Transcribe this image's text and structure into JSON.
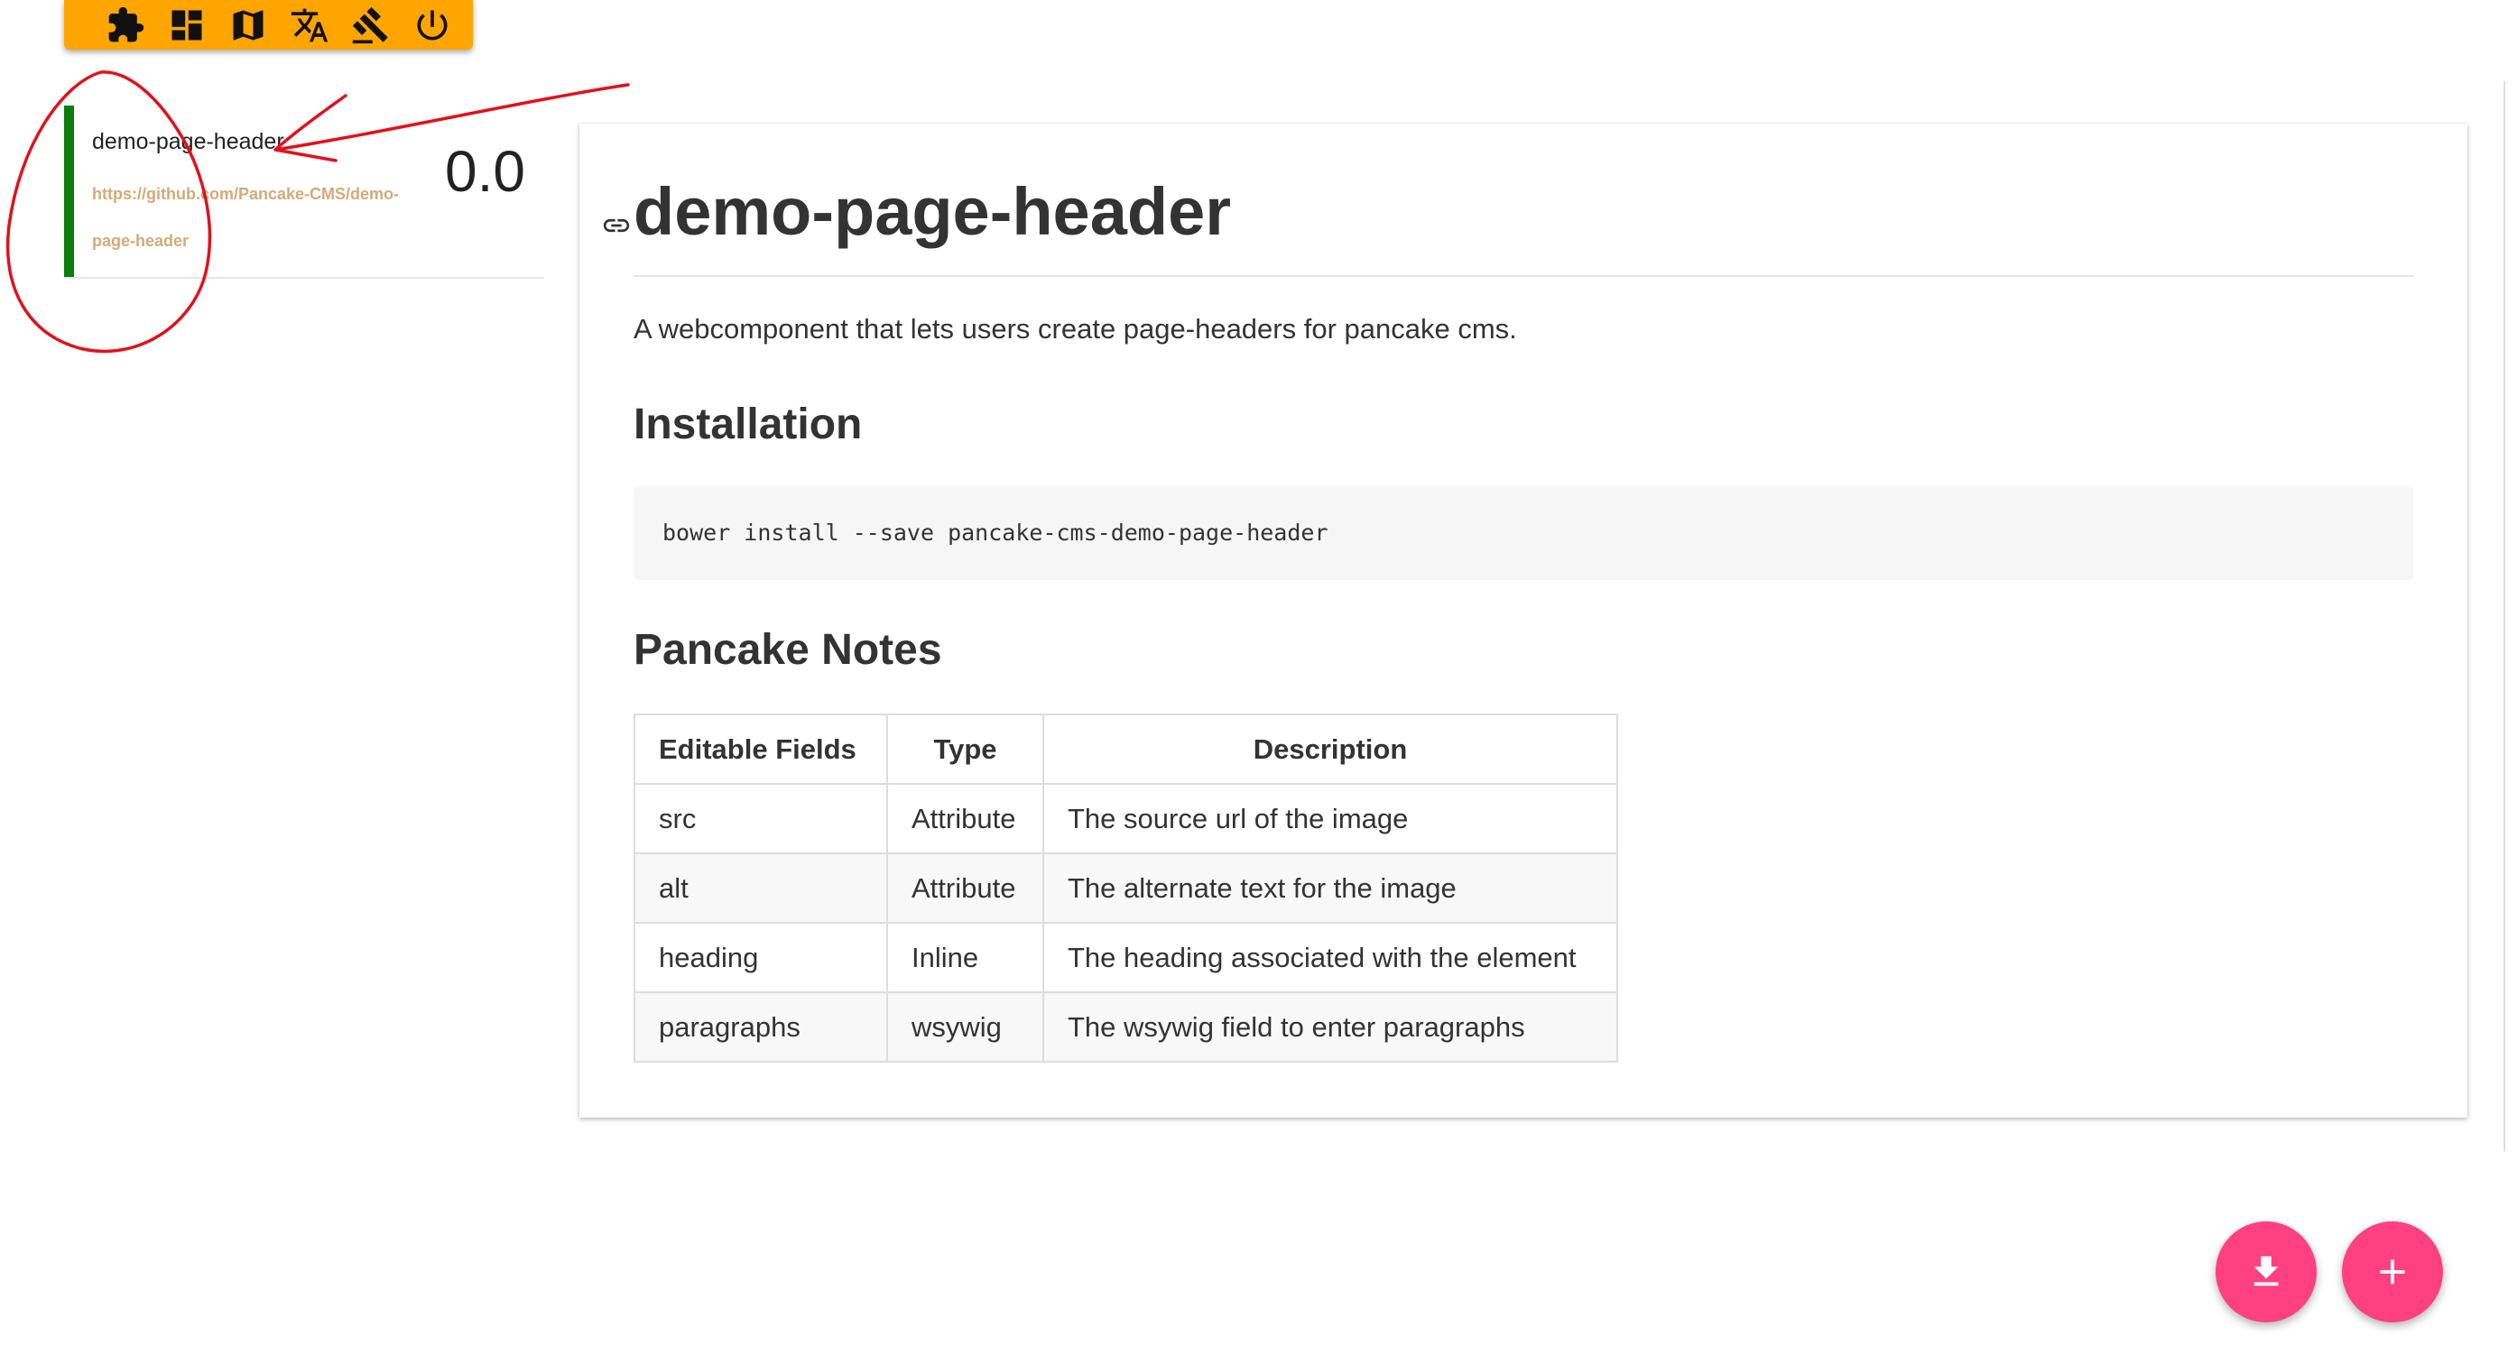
{
  "toolbar": {
    "background": "#FFA500",
    "buttons": [
      {
        "icon": "puzzle-icon"
      },
      {
        "icon": "dashboard-icon"
      },
      {
        "icon": "map-icon"
      },
      {
        "icon": "translate-icon"
      },
      {
        "icon": "gavel-icon"
      },
      {
        "icon": "power-icon"
      }
    ]
  },
  "sidebar": {
    "element": {
      "name": "demo-page-header",
      "url_line1": "https://github.com/Pancake-CMS/demo-",
      "url_line2": "page-header",
      "version": "0.0",
      "status_color": "#0a7d0a"
    }
  },
  "doc": {
    "title": "demo-page-header",
    "description": "A webcomponent that lets users create page-headers for pancake cms.",
    "installation_heading": "Installation",
    "install_command": "bower install --save pancake-cms-demo-page-header",
    "notes_heading": "Pancake Notes",
    "table": {
      "headers": [
        "Editable Fields",
        "Type",
        "Description"
      ],
      "rows": [
        [
          "src",
          "Attribute",
          "The source url of the image"
        ],
        [
          "alt",
          "Attribute",
          "The alternate text for the image"
        ],
        [
          "heading",
          "Inline",
          "The heading associated with the element"
        ],
        [
          "paragraphs",
          "wsywig",
          "The wsywig field to enter paragraphs"
        ]
      ]
    }
  },
  "fabs": {
    "color": "#FF4081",
    "download_icon": "download-icon",
    "add_icon": "plus-icon"
  },
  "annotation": {
    "color": "#E0121B",
    "marks": [
      "circle-mark",
      "arrow-mark"
    ]
  }
}
